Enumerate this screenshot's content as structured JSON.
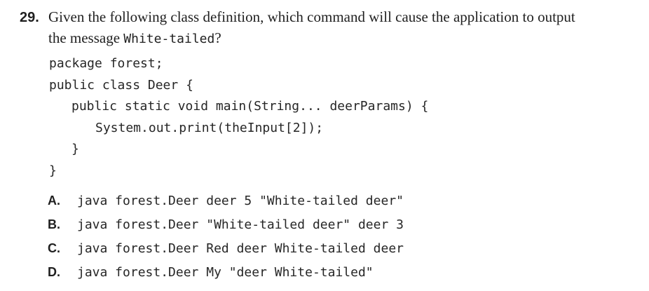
{
  "question": {
    "number": "29.",
    "line1": "Given the following class definition, which command will cause the application to output",
    "line2_prefix": "the message ",
    "line2_code": "White-tailed",
    "line2_suffix": "?"
  },
  "code": {
    "lines": [
      "package forest;",
      "public class Deer {",
      "public static void main(String... deerParams) {",
      "System.out.print(theInput[2]);",
      "}",
      "}"
    ]
  },
  "answers": [
    {
      "letter": "A.",
      "text": "java forest.Deer deer 5 \"White-tailed deer\""
    },
    {
      "letter": "B.",
      "text": "java forest.Deer \"White-tailed deer\" deer 3"
    },
    {
      "letter": "C.",
      "text": "java forest.Deer Red deer White-tailed deer"
    },
    {
      "letter": "D.",
      "text": "java forest.Deer My \"deer White-tailed\""
    }
  ]
}
